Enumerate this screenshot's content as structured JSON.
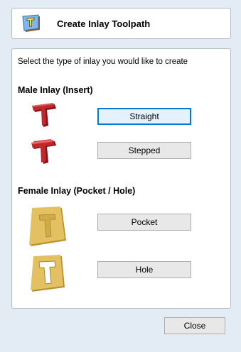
{
  "header": {
    "title": "Create Inlay Toolpath",
    "icon": "inlay-toolpath-icon"
  },
  "panel": {
    "instructions": "Select the type of inlay you would like to create",
    "male": {
      "heading": "Male Inlay (Insert)",
      "straight_label": "Straight",
      "stepped_label": "Stepped"
    },
    "female": {
      "heading": "Female Inlay (Pocket / Hole)",
      "pocket_label": "Pocket",
      "hole_label": "Hole"
    }
  },
  "footer": {
    "close_label": "Close"
  },
  "colors": {
    "background": "#e3ebf5",
    "accent": "#0078d7",
    "insert_red": "#c0282c",
    "brass": "#d9b552"
  }
}
